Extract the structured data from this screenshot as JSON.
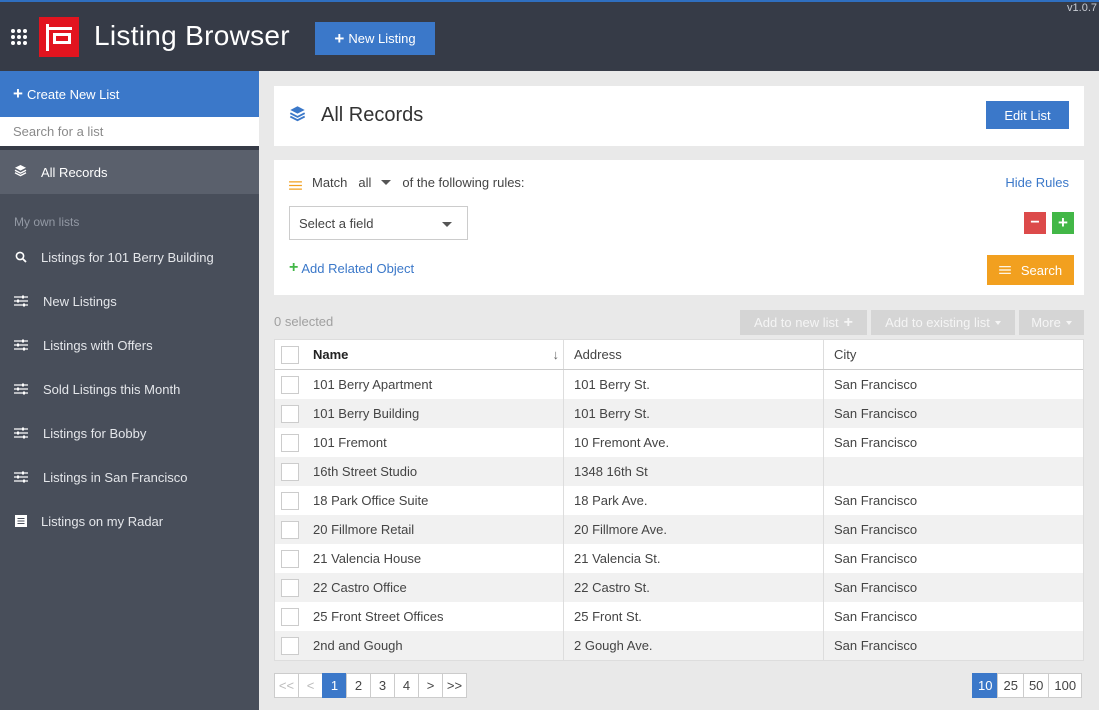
{
  "app": {
    "title": "Listing Browser",
    "version": "v1.0.7",
    "new_listing_label": "New Listing",
    "brand_color": "#e2141f",
    "accent_color": "#3b78c9"
  },
  "sidebar": {
    "create_label": "Create New List",
    "search_placeholder": "Search for a list",
    "all_records_label": "All Records",
    "section_label": "My own lists",
    "items": [
      {
        "label": "Listings for 101 Berry Building",
        "icon": "search-icon"
      },
      {
        "label": "New Listings",
        "icon": "sliders-icon"
      },
      {
        "label": "Listings with Offers",
        "icon": "sliders-icon"
      },
      {
        "label": "Sold Listings this Month",
        "icon": "sliders-icon"
      },
      {
        "label": "Listings for Bobby",
        "icon": "sliders-icon"
      },
      {
        "label": "Listings in San Francisco",
        "icon": "sliders-icon"
      },
      {
        "label": "Listings on my Radar",
        "icon": "list-icon"
      }
    ]
  },
  "header": {
    "title": "All Records",
    "edit_label": "Edit List"
  },
  "rules": {
    "match_label": "Match",
    "match_value": "all",
    "match_tail": "of the following rules:",
    "hide_label": "Hide Rules",
    "field_placeholder": "Select a field",
    "add_related_label": "Add Related Object",
    "search_label": "Search"
  },
  "toolbar": {
    "selected_text": "0 selected",
    "add_new_label": "Add to new list",
    "add_existing_label": "Add to existing list",
    "more_label": "More"
  },
  "table": {
    "columns": [
      "Name",
      "Address",
      "City"
    ],
    "rows": [
      {
        "name": "101 Berry Apartment",
        "address": "101 Berry St.",
        "city": "San Francisco"
      },
      {
        "name": "101 Berry Building",
        "address": "101 Berry St.",
        "city": "San Francisco"
      },
      {
        "name": "101 Fremont",
        "address": "10 Fremont Ave.",
        "city": "San Francisco"
      },
      {
        "name": "16th Street Studio",
        "address": "1348 16th St",
        "city": ""
      },
      {
        "name": "18 Park Office Suite",
        "address": "18 Park Ave.",
        "city": "San Francisco"
      },
      {
        "name": "20 Fillmore Retail",
        "address": "20 Fillmore Ave.",
        "city": "San Francisco"
      },
      {
        "name": "21 Valencia House",
        "address": "21 Valencia St.",
        "city": "San Francisco"
      },
      {
        "name": "22 Castro Office",
        "address": "22 Castro St.",
        "city": "San Francisco"
      },
      {
        "name": "25 Front Street Offices",
        "address": "25 Front St.",
        "city": "San Francisco"
      },
      {
        "name": "2nd and Gough",
        "address": "2 Gough Ave.",
        "city": "San Francisco"
      }
    ]
  },
  "pagination": {
    "first": "<<",
    "prev": "<",
    "pages": [
      "1",
      "2",
      "3",
      "4"
    ],
    "current": "1",
    "next": ">",
    "last": ">>",
    "page_sizes": [
      "10",
      "25",
      "50",
      "100"
    ],
    "current_size": "10"
  }
}
